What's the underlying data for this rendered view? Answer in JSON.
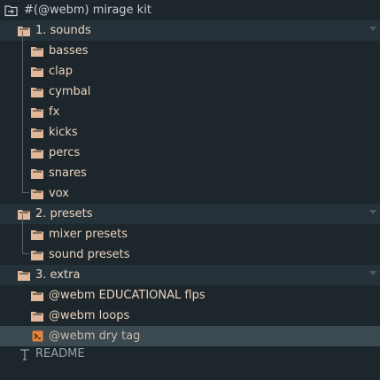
{
  "browser": {
    "root": {
      "label": "#(@webm) mirage kit",
      "icon": "folder-open-icon"
    },
    "groups": [
      {
        "label": "1. sounds",
        "icon": "folder-icon",
        "children": [
          "basses",
          "clap",
          "cymbal",
          "fx",
          "kicks",
          "percs",
          "snares",
          "vox"
        ]
      },
      {
        "label": "2. presets",
        "icon": "folder-icon",
        "children": [
          "mixer presets",
          "sound presets"
        ]
      },
      {
        "label": "3. extra",
        "icon": "folder-icon",
        "children": [
          "@webm EDUCATIONAL flps",
          "@webm loops"
        ]
      }
    ],
    "file": {
      "label": "@webm dry tag",
      "icon": "audio-file-icon"
    },
    "readme": {
      "label": "README",
      "icon": "text-file-icon"
    }
  },
  "colors": {
    "background": "#1c262b",
    "header_row": "#26323a",
    "selected_row": "#3b4950",
    "folder": "#e2b89a",
    "file_icon": "#e8833a",
    "label": "#e9d3c0"
  }
}
